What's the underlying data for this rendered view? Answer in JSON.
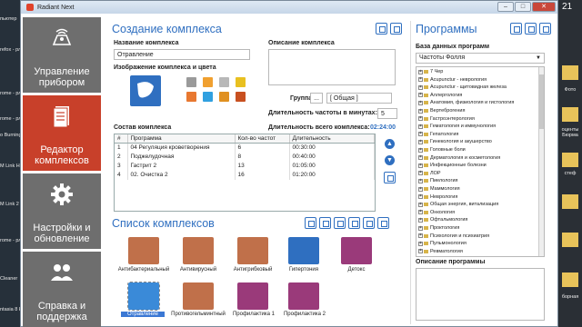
{
  "desktop": {
    "left_items": [
      "пьютер",
      "refox - рлык",
      "",
      "rome - рлык",
      "rome - рлык",
      "o Burning ROM",
      "M Link Home",
      "M Link 2 Home",
      "rome - рлык",
      "",
      "Cleaner",
      "ntasia 8 Home"
    ],
    "clock": "21",
    "right_items": [
      "Фото",
      "Фото",
      "оценты Бюрма",
      "стеф",
      "",
      "борная"
    ]
  },
  "window": {
    "title": "Radiant Next",
    "buttons": [
      "–",
      "□",
      "✕"
    ]
  },
  "nav": [
    {
      "label": "Управление прибором",
      "icon": "device-control-icon",
      "active": false
    },
    {
      "label": "Редактор комплексов",
      "icon": "document-editor-icon",
      "active": true
    },
    {
      "label": "Настройки и обновление",
      "icon": "gear-icon",
      "active": false
    },
    {
      "label": "Справка и поддержка",
      "icon": "people-support-icon",
      "active": false
    }
  ],
  "create": {
    "title": "Создание комплекса",
    "name_label": "Название комплекса",
    "name_value": "Отравление",
    "desc_label": "Описание комплекса",
    "image_label": "Изображение комплекса и цвета",
    "group_label": "Группа",
    "group_value": "[ Общая ]",
    "group_btn": "...",
    "freq_label": "Длительность частоты в минутах:",
    "freq_value": "5",
    "total_label": "Длительность всего комплекса:",
    "total_value": "02:24:00",
    "composition_label": "Состав комплекса",
    "colors": [
      "#9a9a9a",
      "#f0a030",
      "#b8b8b8",
      "#e8c020",
      "#e87830",
      "#30a0e0",
      "#e09020",
      "#c85020"
    ]
  },
  "composition_table": {
    "headers": [
      "#",
      "Программа",
      "Кол-во частот",
      "Длительность"
    ],
    "rows": [
      [
        "1",
        "04 Регуляция кроветворения",
        "6",
        "00:30:00"
      ],
      [
        "2",
        "Поджелудочная",
        "8",
        "00:40:00"
      ],
      [
        "3",
        "Гастрит 2",
        "13",
        "01:05:00"
      ],
      [
        "4",
        "02. Очистка 2",
        "16",
        "01:20:00"
      ]
    ]
  },
  "list": {
    "title": "Список комплексов",
    "tiles": [
      {
        "label": "Антибактериальный",
        "color": "#c0704a",
        "selected": false
      },
      {
        "label": "Антивирусный",
        "color": "#c0704a",
        "selected": false
      },
      {
        "label": "Антигрибковый",
        "color": "#c0704a",
        "selected": false
      },
      {
        "label": "Гипертония",
        "color": "#2f6fc0",
        "selected": false
      },
      {
        "label": "Детокс",
        "color": "#9a3a7a",
        "selected": false
      },
      {
        "label": "Отравление",
        "color": "#3a8ad8",
        "selected": true
      },
      {
        "label": "Противогельминтный",
        "color": "#c0704a",
        "selected": false
      },
      {
        "label": "Профилактика 1",
        "color": "#9a3a7a",
        "selected": false
      },
      {
        "label": "Профилактика 2",
        "color": "#9a3a7a",
        "selected": false
      }
    ]
  },
  "programs": {
    "title": "Программы",
    "db_label": "База данных программ",
    "db_value": "Частоты Фолля",
    "tree": [
      "7 Чер",
      "Acupunctur - неврология",
      "Acupunctur - щитовидная железа",
      "Аллергология",
      "Анатомия, физиология и гистология",
      "Вертеброгения",
      "Гастроэнтерология",
      "Гематология и иммунология",
      "Гепатология",
      "Гинекология и акушерство",
      "Головные боли",
      "Дерматология и косметология",
      "Инфекционные болезни",
      "ЛОР",
      "Пиелология",
      "Маммология",
      "Неврология",
      "Общая энергия, витализация",
      "Онкология",
      "Офтальмология",
      "Проктология",
      "Психология и психиатрия",
      "Пульмонология",
      "Ревматология"
    ],
    "desc_label": "Описание программы"
  }
}
